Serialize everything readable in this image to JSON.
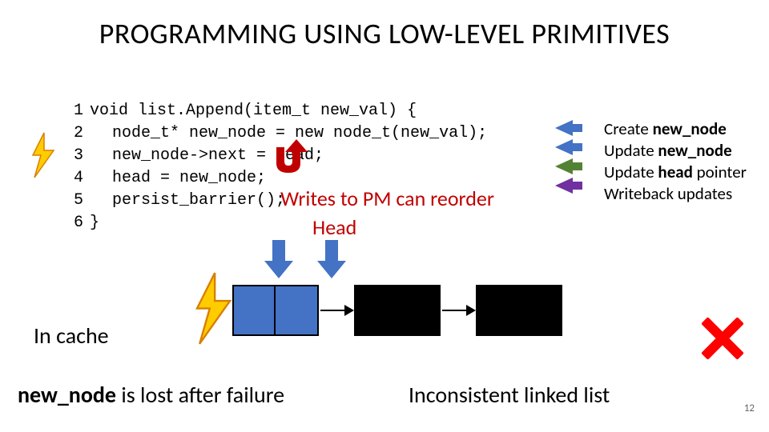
{
  "title": "PROGRAMMING USING LOW-LEVEL PRIMITIVES",
  "code": {
    "l1": {
      "num": "1",
      "text": "void list.Append(item_t new_val) {"
    },
    "l2": {
      "num": "2",
      "text": "node_t* new_node = new node_t(new_val);"
    },
    "l3": {
      "num": "3",
      "text": "new_node->next = head;"
    },
    "l4": {
      "num": "4",
      "text": "head = new_node;"
    },
    "l5": {
      "num": "5",
      "text": "persist_barrier();"
    },
    "l6": {
      "num": "6",
      "text": "}"
    }
  },
  "reorder_label": "Writes to PM can reorder",
  "head_label": "Head",
  "annotations": {
    "a1": {
      "pre": "Create ",
      "bold": "new_node"
    },
    "a2": {
      "pre": "Update ",
      "bold": "new_node"
    },
    "a3": {
      "pre": "Update ",
      "bold": "head",
      "post": " pointer"
    },
    "a4": {
      "pre": "Writeback updates",
      "bold": "",
      "post": ""
    }
  },
  "incache_label": "In cache",
  "footer_left_bold": "new_node",
  "footer_left_rest": " is lost after failure",
  "footer_right": "Inconsistent linked list",
  "page_number": "12",
  "colors": {
    "accent_red": "#c00000",
    "arrow_blue": "#4472c4",
    "arrow_green": "#548235",
    "arrow_purple": "#7030a0",
    "bolt_fill": "#ffcc00",
    "cross_red": "#ff0000"
  }
}
